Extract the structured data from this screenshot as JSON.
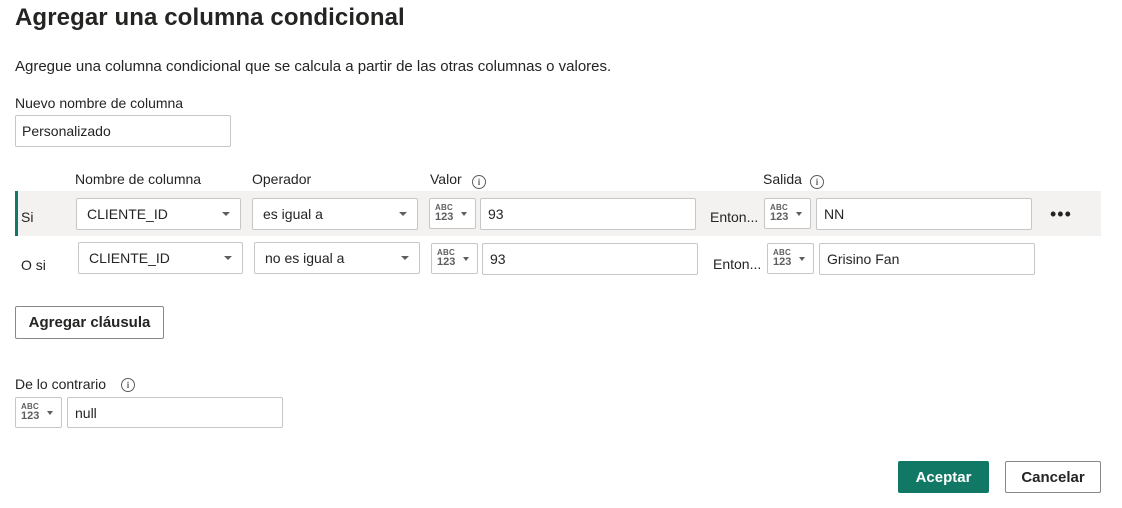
{
  "dialog": {
    "title": "Agregar una columna condicional",
    "description": "Agregue una columna condicional que se calcula a partir de las otras columnas o valores."
  },
  "new_column": {
    "label": "Nuevo nombre de columna",
    "value": "Personalizado"
  },
  "headers": {
    "column_name": "Nombre de columna",
    "operator": "Operador",
    "value": "Valor",
    "output": "Salida",
    "info_glyph": "i"
  },
  "type_selector": {
    "abc": "ABC",
    "n123": "123",
    "icon": "abc-123-type-icon"
  },
  "clauses": [
    {
      "prefix": "Si",
      "column": "CLIENTE_ID",
      "operator": "es igual a",
      "value": "93",
      "then_label": "Enton...",
      "output": "NN",
      "more": "•••"
    },
    {
      "prefix": "O si",
      "column": "CLIENTE_ID",
      "operator": "no es igual a",
      "value": "93",
      "then_label": "Enton...",
      "output": "Grisino Fan"
    }
  ],
  "add_clause_label": "Agregar cláusula",
  "otherwise": {
    "label": "De lo contrario",
    "value": "null"
  },
  "footer": {
    "accept_label": "Aceptar",
    "cancel_label": "Cancelar"
  },
  "colors": {
    "accent": "#117865",
    "selected_row_bg": "#f3f2f1",
    "border": "#c8c6c4"
  }
}
